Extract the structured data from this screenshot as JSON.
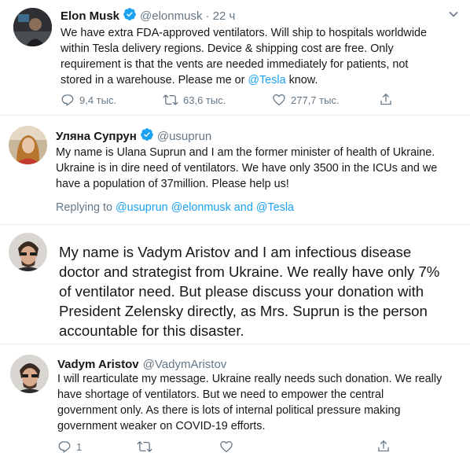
{
  "tweet1": {
    "name": "Elon Musk",
    "handle": "@elonmusk",
    "time": "· 22 ч",
    "text_parts": [
      "We have extra FDA-approved ventilators. Will ship to hospitals worldwide",
      "within Tesla delivery regions. Device & shipping cost are free. Only",
      "requirement is that the vents are needed immediately for patients, not",
      "stored in a warehouse. Please me or "
    ],
    "mention": "@Tesla",
    "text_end": " know.",
    "replies": "9,4 тыс.",
    "retweets": "63,6 тыс.",
    "likes": "277,7 тыс."
  },
  "tweet2": {
    "name": "Уляна Супрун",
    "handle": "@usuprun",
    "lines": [
      "My name is Ulana Suprun and I am the former minister of health of Ukraine.",
      "Ukraine is in dire need of ventilators. We have only 3500 in the ICUs and we",
      "have a population of  37million. Please help us!"
    ],
    "replying_prefix": "Replying to ",
    "replying_links": "@usuprun @elonmusk and @Tesla"
  },
  "tweet3": {
    "lines": [
      "My name is Vadym Aristov and I am infectious disease",
      "doctor and strategist from Ukraine. We really have only 7%",
      "of ventilator need. But please discuss your donation with",
      "President Zelensky directly, as Mrs. Suprun is the person",
      "accountable for this disaster."
    ]
  },
  "tweet4": {
    "name": "Vadym Aristov",
    "handle": "@VadymAristov",
    "lines": [
      "I will rearticulate my message. Ukraine really needs such donation. We really",
      "have shortage of ventilators. But we need to empower the central",
      "government only. As there is lots of internal political pressure making",
      "government weaker on COVID-19 efforts."
    ],
    "replies": "1"
  },
  "icons": {
    "reply": "reply-icon",
    "retweet": "retweet-icon",
    "like": "heart-icon",
    "share": "share-icon",
    "chevron": "chevron-down-icon",
    "verified": "verified-badge-icon"
  },
  "colors": {
    "accent": "#1da1f2",
    "secondary_text": "#657786",
    "divider": "#e6ecf0"
  }
}
